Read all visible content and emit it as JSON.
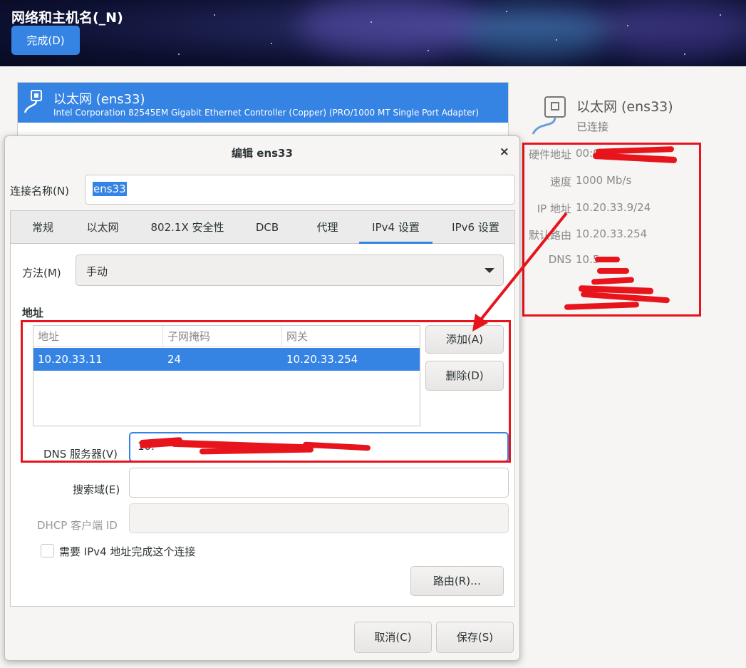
{
  "header": {
    "title": "网络和主机名(_N)",
    "done_label": "完成(D)"
  },
  "connection": {
    "name": "以太网 (ens33)",
    "description": "Intel Corporation 82545EM Gigabit Ethernet Controller (Copper) (PRO/1000 MT Single Port Adapter)"
  },
  "details": {
    "name": "以太网 (ens33)",
    "status": "已连接",
    "rows": [
      {
        "label": "硬件地址",
        "value": "00:0C"
      },
      {
        "label": "速度",
        "value": "1000 Mb/s"
      },
      {
        "label": "IP 地址",
        "value": "10.20.33.9/24"
      },
      {
        "label": "默认路由",
        "value": "10.20.33.254"
      },
      {
        "label": "DNS",
        "value": "10.5"
      }
    ]
  },
  "dialog": {
    "title": "编辑 ens33",
    "close": "×",
    "conn_name_label": "连接名称(N)",
    "conn_name_value": "ens33",
    "tabs": [
      "常规",
      "以太网",
      "802.1X 安全性",
      "DCB",
      "代理",
      "IPv4 设置",
      "IPv6 设置"
    ],
    "active_tab": "IPv4 设置",
    "method_label": "方法(M)",
    "method_value": "手动",
    "address_title": "地址",
    "columns": [
      "地址",
      "子网掩码",
      "网关"
    ],
    "rows": [
      {
        "address": "10.20.33.11",
        "netmask": "24",
        "gateway": "10.20.33.254"
      }
    ],
    "add_label": "添加(A)",
    "delete_label": "删除(D)",
    "dns_label": "DNS 服务器(V)",
    "dns_value": "10.",
    "search_label": "搜索域(E)",
    "search_value": "",
    "dhcp_label": "DHCP 客户端 ID",
    "dhcp_value": "",
    "require_ipv4_label": "需要 IPv4 地址完成这个连接",
    "routes_label": "路由(R)…",
    "cancel_label": "取消(C)",
    "save_label": "保存(S)"
  },
  "colors": {
    "accent": "#3584e4",
    "annotation": "#e8141c"
  }
}
